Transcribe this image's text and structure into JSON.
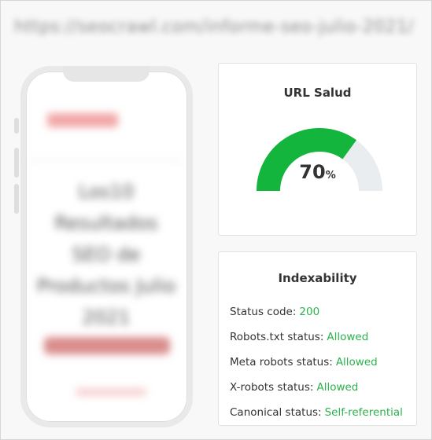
{
  "browser": {
    "url": "https://seocrawl.com/informe-seo-julio-2021/"
  },
  "preview": {
    "heading_lines": [
      "Los10",
      "Resultados",
      "SEO de",
      "Productos Julio",
      "2021"
    ]
  },
  "health": {
    "title": "URL Salud",
    "score": 70,
    "score_display": "70",
    "unit": "%",
    "fill_color": "#13b53c",
    "track_color": "#e9edf0"
  },
  "indexability": {
    "title": "Indexability",
    "rows": [
      {
        "label": "Status code:",
        "value": "200"
      },
      {
        "label": "Robots.txt status:",
        "value": "Allowed"
      },
      {
        "label": "Meta robots status:",
        "value": "Allowed"
      },
      {
        "label": "X-robots status:",
        "value": "Allowed"
      },
      {
        "label": "Canonical status:",
        "value": "Self-referential"
      }
    ],
    "value_color": "#2bb24c"
  }
}
